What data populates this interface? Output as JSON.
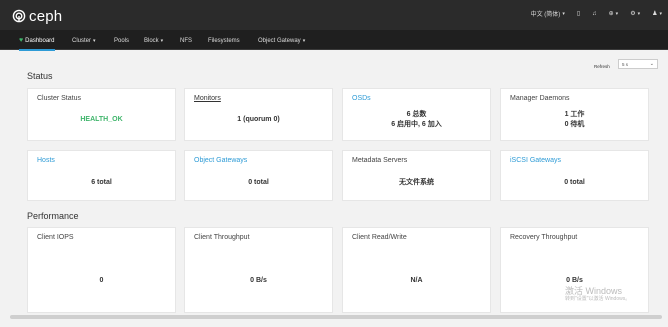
{
  "header": {
    "logo_text": "ceph",
    "utilities": [
      {
        "label": "中文 (简体)",
        "has_caret": true
      },
      {
        "label": "▯",
        "has_caret": false
      },
      {
        "label": "♫",
        "has_caret": false
      },
      {
        "label": "⊕",
        "has_caret": true
      },
      {
        "label": "⚙",
        "has_caret": true
      },
      {
        "label": "♟",
        "has_caret": true
      }
    ]
  },
  "nav": {
    "items": [
      {
        "label": "Dashboard",
        "active": true,
        "has_caret": false
      },
      {
        "label": "Cluster",
        "active": false,
        "has_caret": true
      },
      {
        "label": "Pools",
        "active": false,
        "has_caret": false
      },
      {
        "label": "Block",
        "active": false,
        "has_caret": true
      },
      {
        "label": "NFS",
        "active": false,
        "has_caret": false
      },
      {
        "label": "Filesystems",
        "active": false,
        "has_caret": false
      },
      {
        "label": "Object Gateway",
        "active": false,
        "has_caret": true
      }
    ]
  },
  "status_section": {
    "title": "Status",
    "refresh_label": "Refresh",
    "refresh_value": "5 s",
    "cards": [
      {
        "title": "Cluster Status",
        "lines": [
          "HEALTH_OK"
        ]
      },
      {
        "title": "Monitors",
        "lines": [
          "1 (quorum 0)"
        ]
      },
      {
        "title": "OSDs",
        "lines": [
          "6 总数",
          "6 启用中, 6 加入"
        ]
      },
      {
        "title": "Manager Daemons",
        "lines": [
          "1 工作",
          "0 待机"
        ]
      },
      {
        "title": "Hosts",
        "lines": [
          "6 total"
        ]
      },
      {
        "title": "Object Gateways",
        "lines": [
          "0 total"
        ]
      },
      {
        "title": "Metadata Servers",
        "lines": [
          "无文件系统"
        ]
      },
      {
        "title": "iSCSI Gateways",
        "lines": [
          "0 total"
        ]
      }
    ]
  },
  "performance_section": {
    "title": "Performance",
    "cards": [
      {
        "title": "Client IOPS",
        "lines": [
          "0"
        ]
      },
      {
        "title": "Client Throughput",
        "lines": [
          "0 B/s"
        ]
      },
      {
        "title": "Client Read/Write",
        "lines": [
          "N/A"
        ]
      },
      {
        "title": "Recovery Throughput",
        "lines": [
          "0 B/s"
        ]
      }
    ]
  },
  "watermark": {
    "line1": "激活 Windows",
    "line2": "转到\"设置\"以激活 Windows。"
  }
}
